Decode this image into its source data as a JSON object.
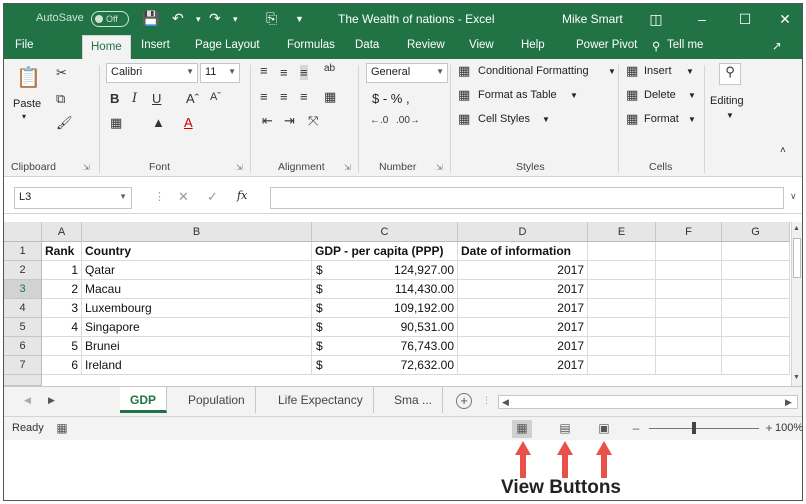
{
  "titlebar": {
    "autosave_label": "AutoSave",
    "autosave_state": "Off",
    "document_title": "The Wealth of nations  -  Excel",
    "user_name": "Mike Smart",
    "accent_color": "#217346"
  },
  "tabs": [
    "File",
    "Home",
    "Insert",
    "Page Layout",
    "Formulas",
    "Data",
    "Review",
    "View",
    "Help",
    "Power Pivot"
  ],
  "tell_me": "Tell me",
  "active_tab": "Home",
  "ribbon": {
    "clipboard": {
      "paste": "Paste",
      "label": "Clipboard"
    },
    "font": {
      "name": "Calibri",
      "size": "11",
      "label": "Font"
    },
    "alignment": {
      "label": "Alignment"
    },
    "number": {
      "format": "General",
      "symbols": "$  -  %  ,",
      "label": "Number"
    },
    "styles": {
      "conditional": "Conditional Formatting",
      "format_table": "Format as Table",
      "cell_styles": "Cell Styles",
      "label": "Styles"
    },
    "cells": {
      "insert": "Insert",
      "delete": "Delete",
      "format": "Format",
      "label": "Cells"
    },
    "editing": {
      "label": "Editing"
    }
  },
  "formula_bar": {
    "name_box": "L3",
    "fx": "fx"
  },
  "grid": {
    "columns": [
      "A",
      "B",
      "C",
      "D",
      "E",
      "F",
      "G"
    ],
    "row_numbers": [
      "1",
      "2",
      "3",
      "4",
      "5",
      "6",
      "7"
    ],
    "header": {
      "rank": "Rank",
      "country": "Country",
      "gdp": "GDP - per capita (PPP)",
      "date": "Date of information"
    },
    "rows": [
      {
        "rank": "1",
        "country": "Qatar",
        "currency": "$",
        "gdp": "124,927.00",
        "date": "2017"
      },
      {
        "rank": "2",
        "country": "Macau",
        "currency": "$",
        "gdp": "114,430.00",
        "date": "2017"
      },
      {
        "rank": "3",
        "country": "Luxembourg",
        "currency": "$",
        "gdp": "109,192.00",
        "date": "2017"
      },
      {
        "rank": "4",
        "country": "Singapore",
        "currency": "$",
        "gdp": "90,531.00",
        "date": "2017"
      },
      {
        "rank": "5",
        "country": "Brunei",
        "currency": "$",
        "gdp": "76,743.00",
        "date": "2017"
      },
      {
        "rank": "6",
        "country": "Ireland",
        "currency": "$",
        "gdp": "72,632.00",
        "date": "2017"
      }
    ]
  },
  "sheets": [
    "GDP",
    "Population",
    "Life Expectancy",
    "Sma ..."
  ],
  "active_sheet": "GDP",
  "status": {
    "text": "Ready",
    "zoom": "100%"
  },
  "annotation": {
    "label": "View Buttons",
    "arrow_color": "#e8504a"
  }
}
